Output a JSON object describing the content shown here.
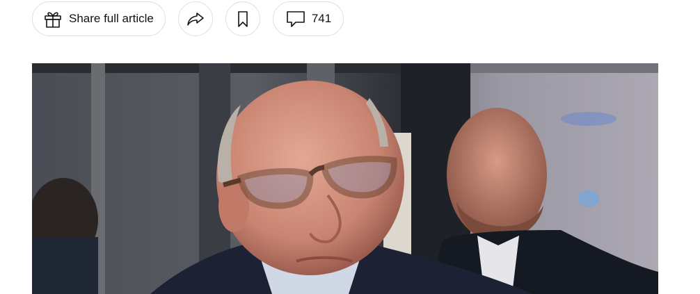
{
  "toolbar": {
    "share_label": "Share full article",
    "comment_count": "741",
    "icons": {
      "share": "gift-icon",
      "forward": "forward-arrow-icon",
      "bookmark": "bookmark-icon",
      "comments": "comment-bubble-icon"
    }
  },
  "article_image": {
    "subject": "photo-of-man-with-glasses"
  },
  "colors": {
    "border": "#dfdfdf",
    "text": "#121212"
  }
}
